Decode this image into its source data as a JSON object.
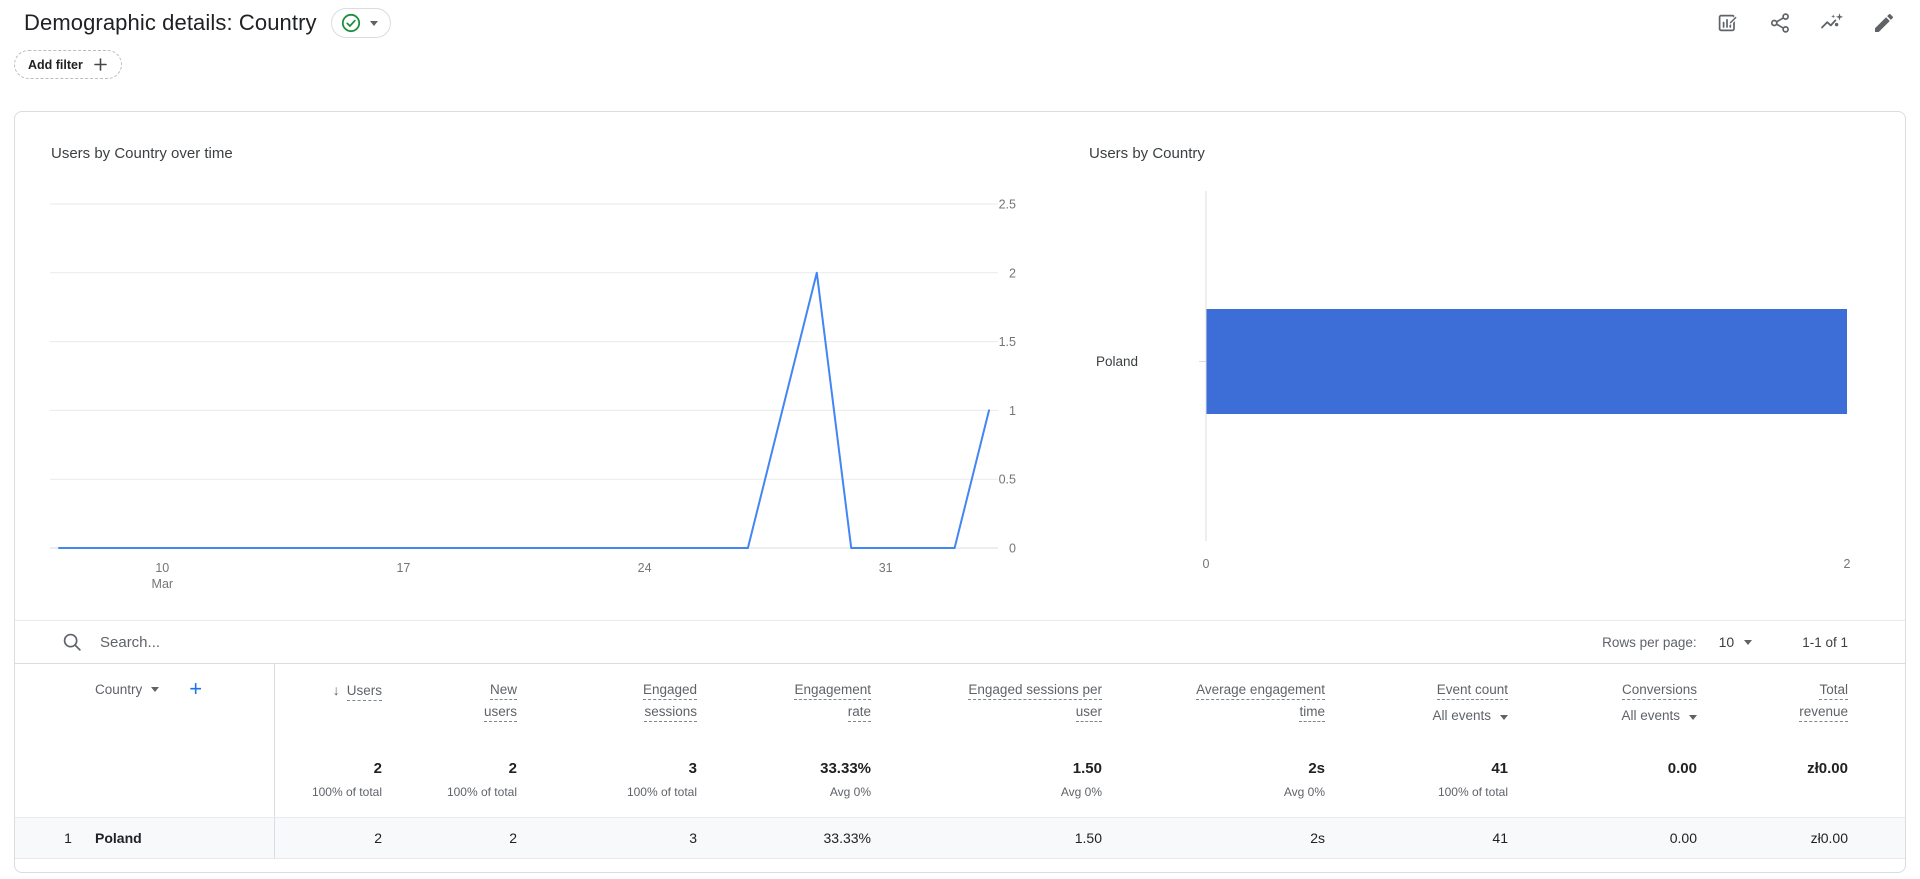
{
  "header": {
    "title": "Demographic details: Country",
    "add_filter_label": "Add filter",
    "action_icons": [
      "customize-report",
      "share",
      "view-insights",
      "edit"
    ]
  },
  "chart_data": [
    {
      "type": "line",
      "title": "Users by Country over time",
      "x": [
        "Mar 7",
        "Mar 8",
        "Mar 9",
        "Mar 10",
        "Mar 11",
        "Mar 12",
        "Mar 13",
        "Mar 14",
        "Mar 15",
        "Mar 16",
        "Mar 17",
        "Mar 18",
        "Mar 19",
        "Mar 20",
        "Mar 21",
        "Mar 22",
        "Mar 23",
        "Mar 24",
        "Mar 25",
        "Mar 26",
        "Mar 27",
        "Mar 28",
        "Mar 29",
        "Mar 30",
        "Mar 31",
        "Apr 1",
        "Apr 2",
        "Apr 3"
      ],
      "series": [
        {
          "name": "Users",
          "values": [
            0,
            0,
            0,
            0,
            0,
            0,
            0,
            0,
            0,
            0,
            0,
            0,
            0,
            0,
            0,
            0,
            0,
            0,
            0,
            0,
            0,
            1,
            2,
            0,
            0,
            0,
            0,
            1
          ]
        }
      ],
      "ylim": [
        0,
        2.5
      ],
      "yticks": [
        0,
        0.5,
        1,
        1.5,
        2,
        2.5
      ],
      "ytick_labels": [
        "0",
        "0.5",
        "1",
        "1.5",
        "2",
        "2.5"
      ],
      "xticks": [
        {
          "i": 3,
          "lines": [
            "10",
            "Mar"
          ]
        },
        {
          "i": 10,
          "lines": [
            "17"
          ]
        },
        {
          "i": 17,
          "lines": [
            "24"
          ]
        },
        {
          "i": 24,
          "lines": [
            "31"
          ]
        }
      ],
      "y_axis_side": "right",
      "grid": true,
      "line_color": "#4285f4"
    },
    {
      "type": "bar",
      "orientation": "horizontal",
      "title": "Users by Country",
      "categories": [
        "Poland"
      ],
      "values": [
        2
      ],
      "xlim": [
        0,
        2
      ],
      "xtick_labels": [
        "0",
        "2"
      ],
      "bar_color": "#3d6ed8"
    }
  ],
  "table": {
    "toolbar": {
      "search_placeholder": "Search...",
      "rows_per_page_label": "Rows per page:",
      "rows_per_page_value": "10",
      "pagination": "1-1 of 1"
    },
    "dimension_label": "Country",
    "columns": [
      {
        "lines": [
          "Users"
        ],
        "sorted": "desc"
      },
      {
        "lines": [
          "New",
          "users"
        ]
      },
      {
        "lines": [
          "Engaged",
          "sessions"
        ]
      },
      {
        "lines": [
          "Engagement",
          "rate"
        ]
      },
      {
        "lines": [
          "Engaged sessions per",
          "user"
        ]
      },
      {
        "lines": [
          "Average engagement",
          "time"
        ]
      },
      {
        "lines": [
          "Event count"
        ],
        "filter": "All events"
      },
      {
        "lines": [
          "Conversions"
        ],
        "filter": "All events"
      },
      {
        "lines": [
          "Total",
          "revenue"
        ]
      }
    ],
    "totals": [
      {
        "value": "2",
        "sub": "100% of total"
      },
      {
        "value": "2",
        "sub": "100% of total"
      },
      {
        "value": "3",
        "sub": "100% of total"
      },
      {
        "value": "33.33%",
        "sub": "Avg 0%"
      },
      {
        "value": "1.50",
        "sub": "Avg 0%"
      },
      {
        "value": "2s",
        "sub": "Avg 0%"
      },
      {
        "value": "41",
        "sub": "100% of total"
      },
      {
        "value": "0.00",
        "sub": ""
      },
      {
        "value": "zł0.00",
        "sub": ""
      }
    ],
    "rows": [
      {
        "index": "1",
        "dimension": "Poland",
        "values": [
          "2",
          "2",
          "3",
          "33.33%",
          "1.50",
          "2s",
          "41",
          "0.00",
          "zł0.00"
        ]
      }
    ]
  },
  "colors": {
    "line_blue": "#4285f4",
    "bar_blue": "#3d6ed8",
    "accent_blue": "#1a73e8",
    "check_green": "#1e8e3e",
    "text_primary": "#202124",
    "text_secondary": "#5f6368",
    "border": "#dadce0",
    "gridline": "#e8eaed",
    "row_bg": "#f8f9fa"
  }
}
